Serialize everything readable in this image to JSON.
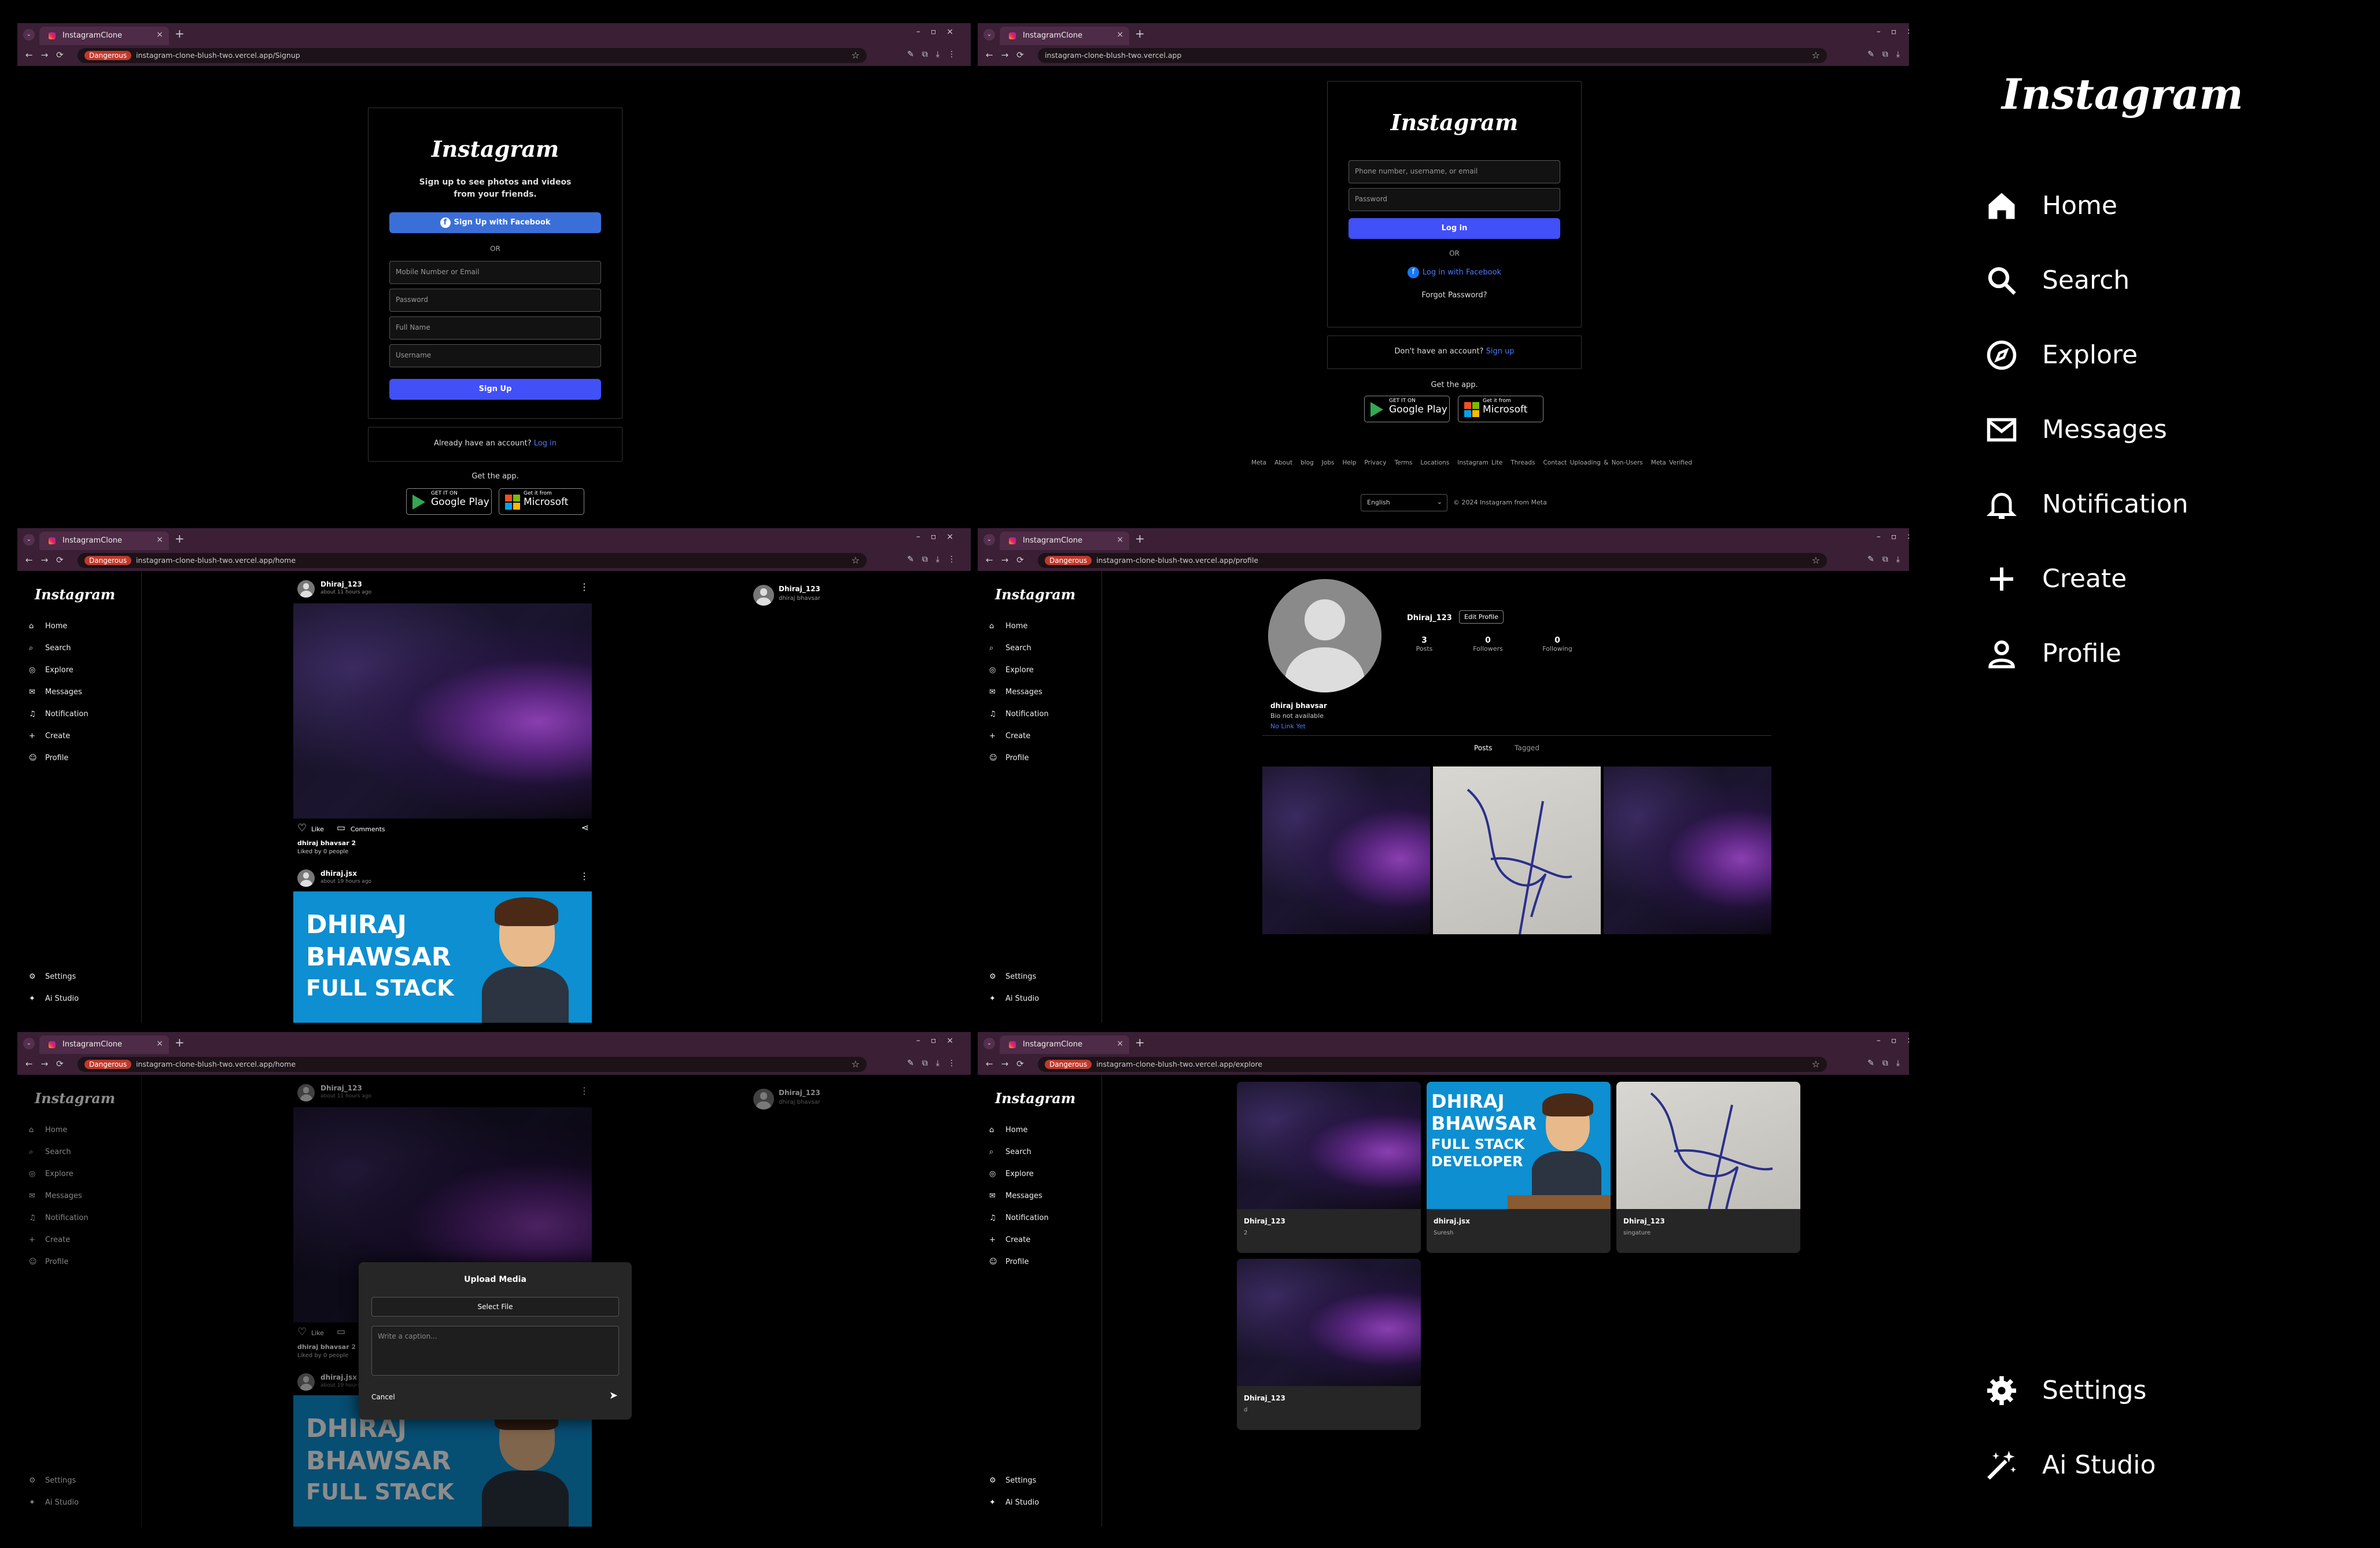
{
  "browser": {
    "tab_title": "InstagramClone",
    "danger_label": "Dangerous",
    "urls": {
      "signup": "instagram-clone-blush-two.vercel.app/Signup",
      "login": "instagram-clone-blush-two.vercel.app",
      "home": "instagram-clone-blush-two.vercel.app/home",
      "profile": "instagram-clone-blush-two.vercel.app/profile",
      "explore": "instagram-clone-blush-two.vercel.app/explore"
    }
  },
  "brand": "Instagram",
  "signup": {
    "tagline": "Sign up to see photos and videos from your friends.",
    "facebook_button": "Sign Up with Facebook",
    "or": "OR",
    "mobile_placeholder": "Mobile Number or Email",
    "password_placeholder": "Password",
    "fullname_placeholder": "Full Name",
    "username_placeholder": "Username",
    "submit": "Sign Up",
    "have_account": "Already have an account?",
    "login_link": "Log in",
    "get_app": "Get the app."
  },
  "login": {
    "user_placeholder": "Phone number, username, or email",
    "password_placeholder": "Password",
    "submit": "Log in",
    "or": "OR",
    "facebook_link": "Log in with Facebook",
    "forgot": "Forgot Password?",
    "no_account": "Don't have an account?",
    "signup_link": "Sign up",
    "get_app": "Get the app.",
    "footer_links": [
      "Meta",
      "About",
      "blog",
      "Jobs",
      "Help",
      "Privacy",
      "Terms",
      "Locations",
      "Instagram Lite",
      "Threads",
      "Contact Uploading & Non-Users",
      "Meta Verified"
    ],
    "language": "English",
    "copyright": "© 2024 Instagram from Meta"
  },
  "stores": {
    "google_small": "GET IT ON",
    "google_big": "Google Play",
    "ms_small": "Get it from",
    "ms_big": "Microsoft"
  },
  "sidebar": {
    "items": [
      "Home",
      "Search",
      "Explore",
      "Messages",
      "Notification",
      "Create",
      "Profile"
    ],
    "bottom": [
      "Settings",
      "Ai Studio"
    ]
  },
  "feed": {
    "post1": {
      "user": "Dhiraj_123",
      "time": "about 11 hours ago",
      "like": "Like",
      "comments": "Comments",
      "caption": "dhiraj bhavsar 2",
      "likes": "Liked by 0 people"
    },
    "post2": {
      "user": "dhiraj.jsx",
      "time": "about 19 hours ago"
    },
    "suggest": {
      "user": "Dhiraj_123",
      "name": "dhiraj bhavsar"
    },
    "banner_lines": [
      "DHIRAJ",
      "BHAWSAR",
      "FULL STACK"
    ]
  },
  "profile": {
    "username": "Dhiraj_123",
    "edit": "Edit Profile",
    "stats": [
      {
        "n": "3",
        "l": "Posts"
      },
      {
        "n": "0",
        "l": "Followers"
      },
      {
        "n": "0",
        "l": "Following"
      }
    ],
    "name": "dhiraj bhavsar",
    "bio": "Bio not available",
    "link": "No Link Yet",
    "tabs": [
      "Posts",
      "Tagged"
    ]
  },
  "upload": {
    "title": "Upload Media",
    "select": "Select File",
    "caption_placeholder": "Write a caption...",
    "cancel": "Cancel"
  },
  "explore": {
    "cards": [
      {
        "user": "Dhiraj_123",
        "caption": "2"
      },
      {
        "user": "dhiraj.jsx",
        "caption": "Suresh"
      },
      {
        "user": "Dhiraj_123",
        "caption": "singature"
      },
      {
        "user": "Dhiraj_123",
        "caption": "d"
      }
    ],
    "banner_lines": [
      "DHIRAJ",
      "BHAWSAR",
      "FULL STACK",
      "DEVELOPER"
    ]
  },
  "big_sidebar": {
    "items": [
      "Home",
      "Search",
      "Explore",
      "Messages",
      "Notification",
      "Create",
      "Profile"
    ],
    "bottom": [
      "Settings",
      "Ai Studio"
    ]
  }
}
